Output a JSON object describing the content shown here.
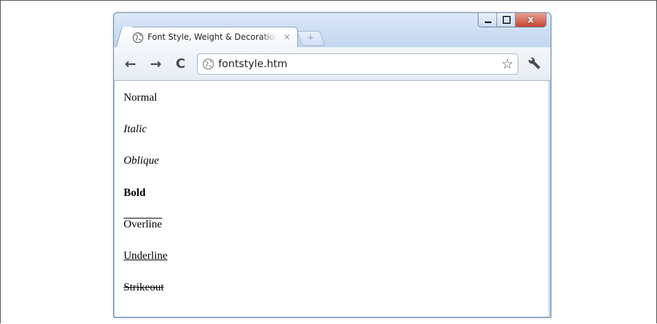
{
  "tab": {
    "title": "Font Style, Weight & Decoration",
    "close_glyph": "×",
    "favicon": "globe-icon"
  },
  "new_tab": {
    "glyph": "+"
  },
  "window_controls": {
    "close_glyph": "x"
  },
  "toolbar": {
    "back_glyph": "←",
    "forward_glyph": "→",
    "reload_glyph": "C",
    "url": "fontstyle.htm",
    "bookmark_glyph": "☆",
    "wrench": "wrench-icon"
  },
  "content": {
    "normal": "Normal",
    "italic": "Italic",
    "oblique": "Oblique",
    "bold": "Bold",
    "overline": "Overline",
    "underline": "Underline",
    "strikeout": "Strikeout"
  },
  "colors": {
    "titlebar": "#c1d6ef",
    "close_button": "#c7452d",
    "text": "#000000"
  }
}
